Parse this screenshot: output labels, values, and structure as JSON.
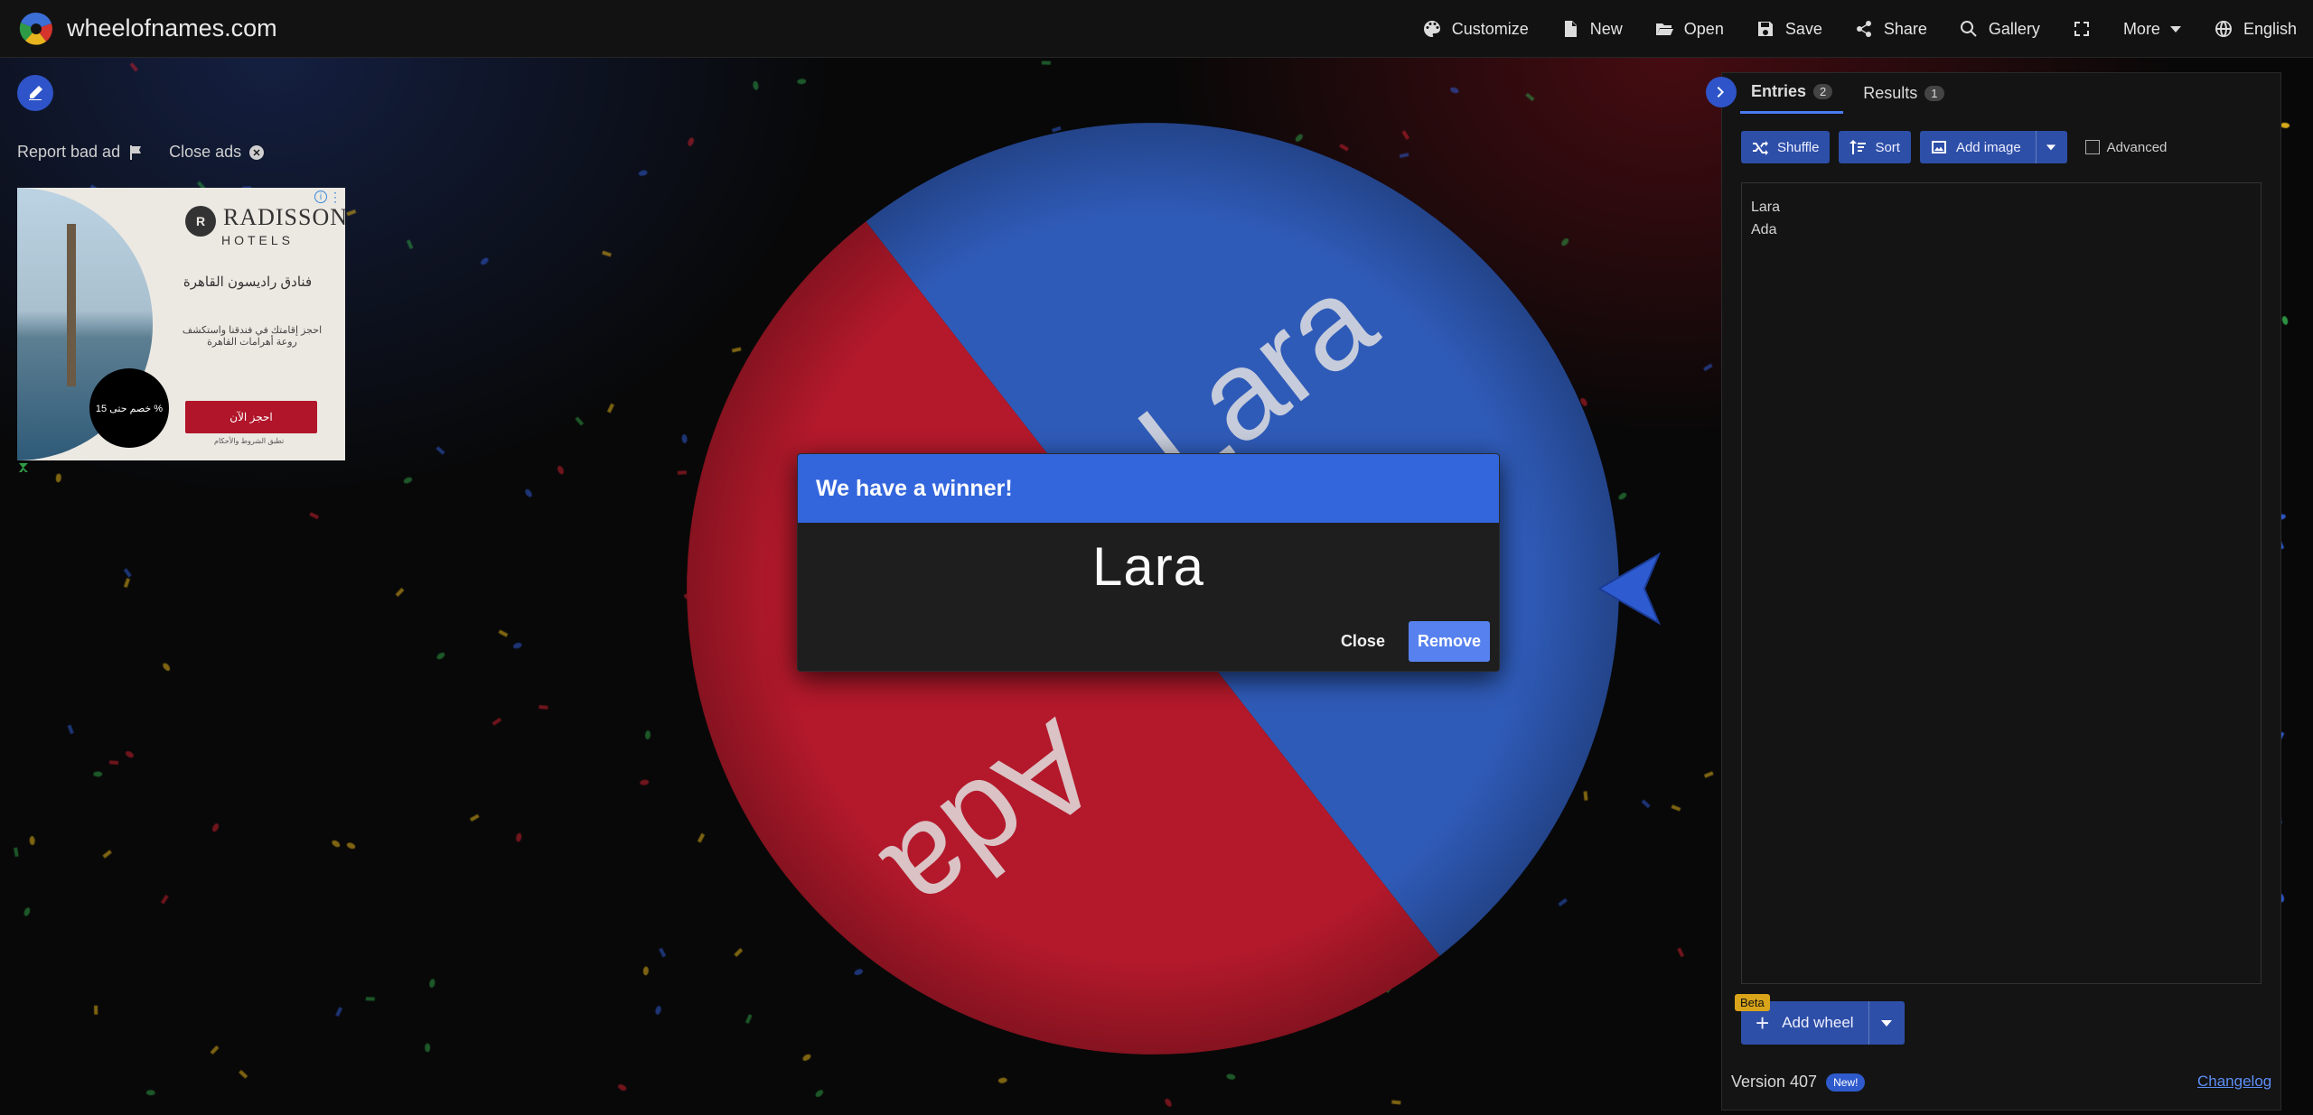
{
  "site": {
    "name": "wheelofnames.com"
  },
  "nav": [
    {
      "label": "Customize",
      "icon": "palette-icon"
    },
    {
      "label": "New",
      "icon": "file-icon"
    },
    {
      "label": "Open",
      "icon": "folder-open-icon"
    },
    {
      "label": "Save",
      "icon": "save-icon"
    },
    {
      "label": "Share",
      "icon": "share-icon"
    },
    {
      "label": "Gallery",
      "icon": "search-icon"
    },
    {
      "label": "",
      "icon": "fullscreen-icon"
    },
    {
      "label": "More",
      "icon": "caret-down-icon"
    },
    {
      "label": "English",
      "icon": "globe-icon"
    }
  ],
  "ads": {
    "report_label": "Report bad ad",
    "close_label": "Close ads",
    "brand": "RADISSON",
    "brand_sub": "HOTELS",
    "headline": "فنادق راديسون القاهرة",
    "body": "احجز إقامتك في فندقنا واستكشف روعة أهرامات القاهرة",
    "badge": "خصم حتى 15 %",
    "cta": "احجز الآن",
    "fine": "تطبق الشروط والأحكام"
  },
  "wheel": {
    "segments": [
      {
        "label": "Lara",
        "color": "#2f5bb8"
      },
      {
        "label": "Ada",
        "color": "#b3192b"
      }
    ]
  },
  "dialog": {
    "title": "We have a winner!",
    "winner": "Lara",
    "close_label": "Close",
    "remove_label": "Remove"
  },
  "panel": {
    "tabs": [
      {
        "label": "Entries",
        "count": "2"
      },
      {
        "label": "Results",
        "count": "1"
      }
    ],
    "toolbar": {
      "shuffle": "Shuffle",
      "sort": "Sort",
      "add_image": "Add image",
      "advanced": "Advanced"
    },
    "entries": [
      "Lara",
      "Ada"
    ],
    "add_wheel": "Add wheel",
    "beta": "Beta",
    "version": "Version 407",
    "new_badge": "New!",
    "changelog": "Changelog"
  },
  "colors": {
    "accent": "#3366dd",
    "header": "#121212",
    "panel": "#141414"
  }
}
